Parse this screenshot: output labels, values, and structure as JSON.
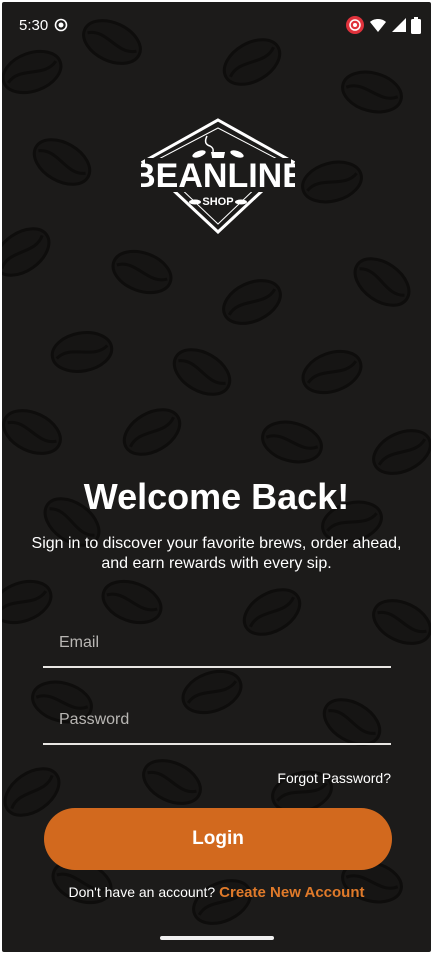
{
  "status_bar": {
    "time": "5:30"
  },
  "logo": {
    "brand": "BEANLINE",
    "sub": "SHOP"
  },
  "welcome": {
    "title": "Welcome Back!",
    "subtitle": "Sign in to discover your favorite brews, order ahead, and earn rewards with every sip."
  },
  "form": {
    "email_placeholder": "Email",
    "password_placeholder": "Password",
    "forgot_label": "Forgot Password?",
    "login_label": "Login"
  },
  "signup": {
    "prompt": "Don't have an account?",
    "link_label": "Create New Account"
  },
  "colors": {
    "background": "#1c1b1a",
    "accent": "#d2691e",
    "link": "#e07a2a"
  }
}
